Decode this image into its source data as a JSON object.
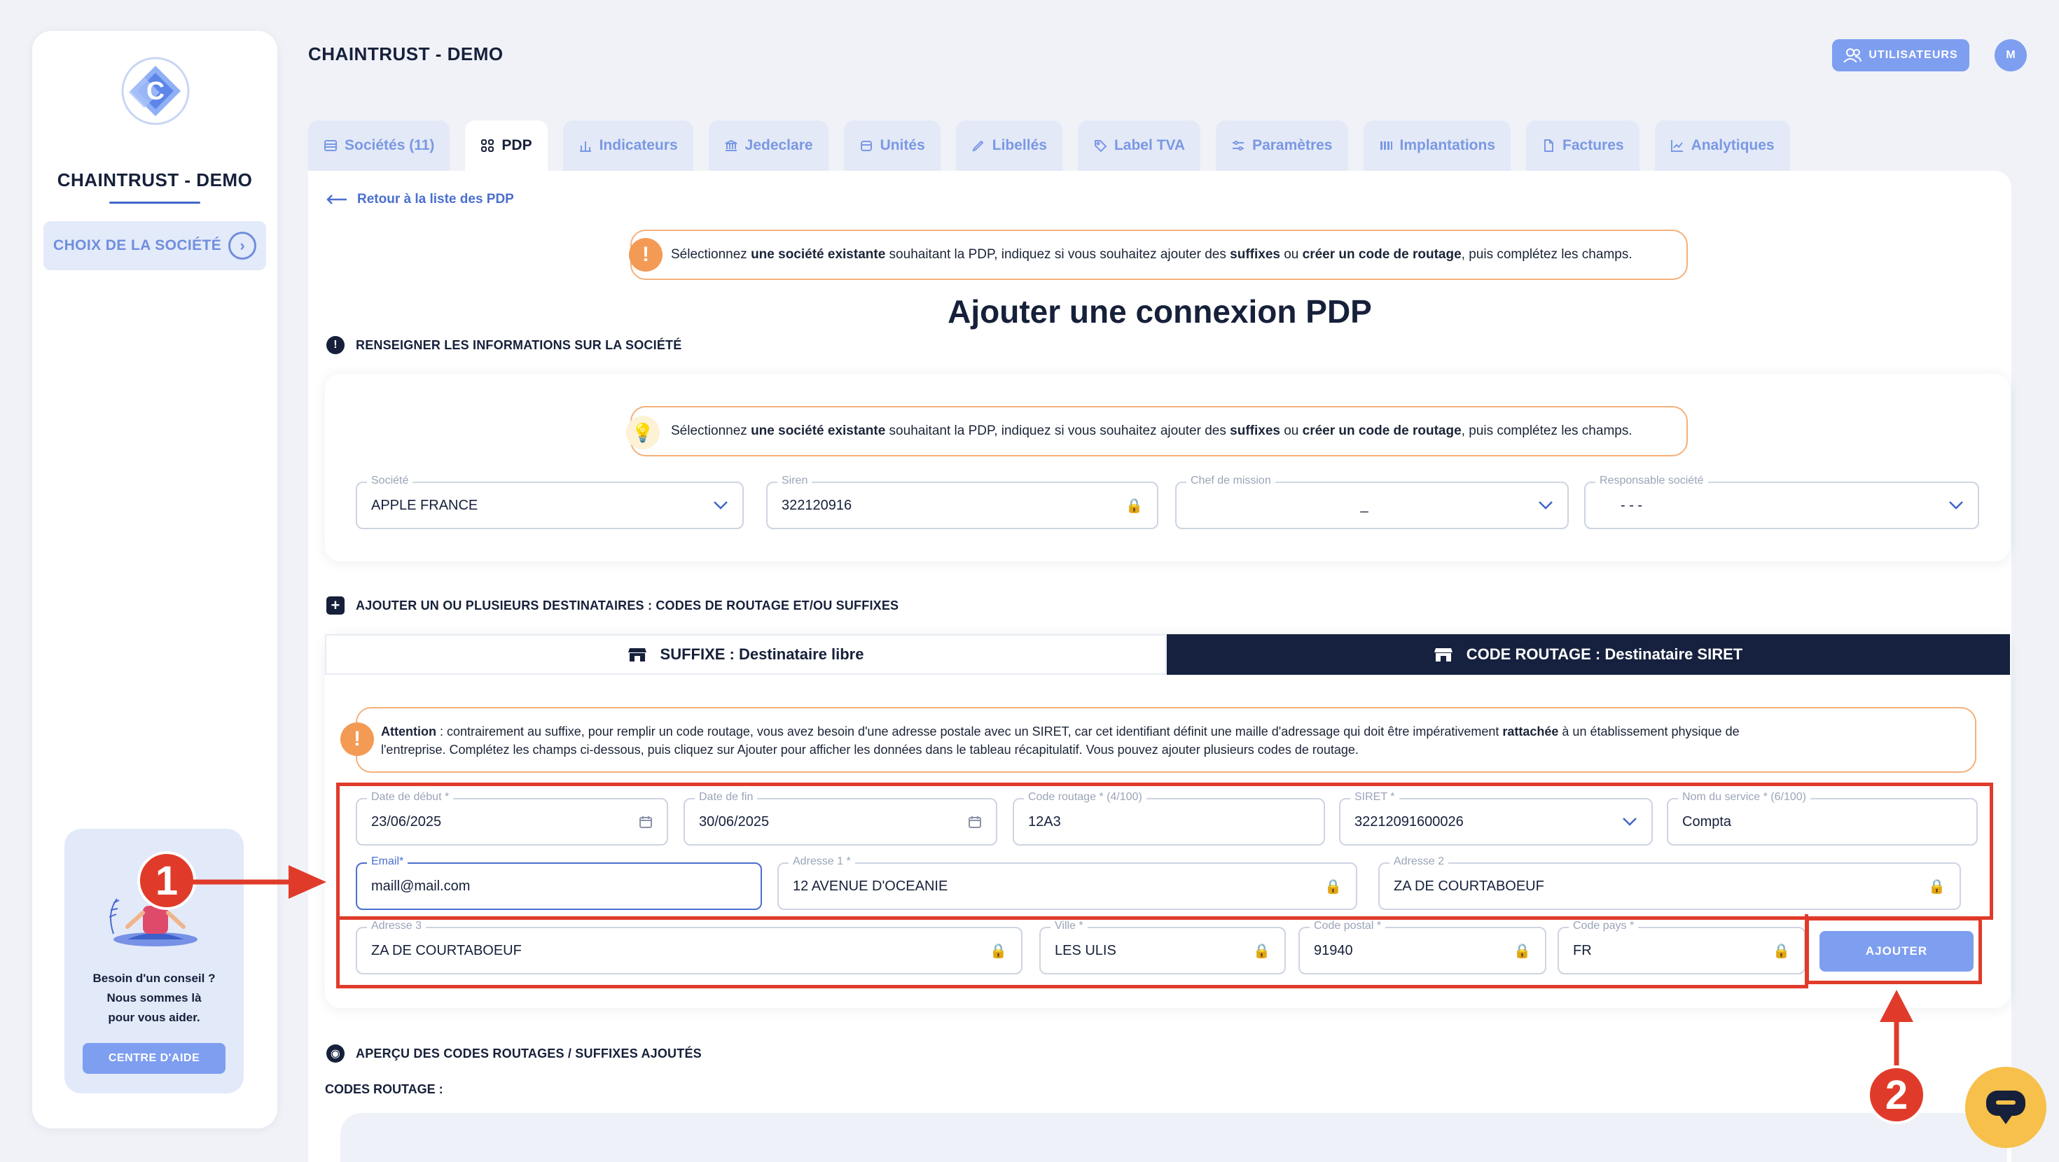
{
  "app": {
    "title": "CHAINTRUST - DEMO",
    "users_label": "UTILISATEURS",
    "avatar_initial": "M"
  },
  "sidebar": {
    "company": "CHAINTRUST - DEMO",
    "choice_label": "CHOIX DE LA SOCIÉTÉ",
    "help_line1": "Besoin d'un conseil ?",
    "help_line2": "Nous sommes là",
    "help_line3": "pour vous aider.",
    "help_button": "CENTRE D'AIDE"
  },
  "tabs": [
    {
      "label": "Sociétés (11)",
      "icon": "table-icon",
      "active": false
    },
    {
      "label": "PDP",
      "icon": "grid-icon",
      "active": true
    },
    {
      "label": "Indicateurs",
      "icon": "bar-chart-icon",
      "active": false
    },
    {
      "label": "Jedeclare",
      "icon": "bank-icon",
      "active": false
    },
    {
      "label": "Unités",
      "icon": "box-icon",
      "active": false
    },
    {
      "label": "Libellés",
      "icon": "pen-icon",
      "active": false
    },
    {
      "label": "Label TVA",
      "icon": "tag-icon",
      "active": false
    },
    {
      "label": "Paramètres",
      "icon": "sliders-icon",
      "active": false
    },
    {
      "label": "Implantations",
      "icon": "columns-icon",
      "active": false
    },
    {
      "label": "Factures",
      "icon": "file-icon",
      "active": false
    },
    {
      "label": "Analytiques",
      "icon": "line-chart-icon",
      "active": false
    }
  ],
  "page": {
    "back_link": "Retour à la liste des PDP",
    "title": "Ajouter une connexion PDP",
    "notice_a": "Sélectionnez ",
    "notice_b": "une société existante",
    "notice_c": " souhaitant la PDP, indiquez si vous souhaitez ajouter des ",
    "notice_d": "suffixes",
    "notice_e": " ou ",
    "notice_f": "créer un code de routage",
    "notice_g": ", puis complétez les champs."
  },
  "company_section": {
    "heading": "RENSEIGNER LES INFORMATIONS SUR LA SOCIÉTÉ",
    "societe_label": "Société",
    "societe_value": "APPLE FRANCE",
    "siren_label": "Siren",
    "siren_value": "322120916",
    "chef_label": "Chef de mission",
    "chef_value": "_",
    "resp_label": "Responsable société",
    "resp_value": "-            - -"
  },
  "recipients_section": {
    "heading": "AJOUTER UN OU PLUSIEURS DESTINATAIRES : CODES DE ROUTAGE ET/OU SUFFIXES",
    "seg_suffix": "SUFFIXE : Destinataire libre",
    "seg_code": "CODE ROUTAGE : Destinataire SIRET",
    "warn_bold1": "Attention",
    "warn_text1": " : contrairement au suffixe, pour remplir un code routage, vous avez besoin d'une adresse postale avec un SIRET, car cet identifiant définit une maille d'adressage qui doit être impérativement ",
    "warn_bold2": "rattachée",
    "warn_text2": " à un établissement physique de",
    "warn_line2": "l'entreprise. Complétez les champs ci-dessous, puis cliquez sur Ajouter pour afficher les données dans le tableau récapitulatif. Vous pouvez ajouter plusieurs codes de routage.",
    "fields": {
      "date_debut_label": "Date de début *",
      "date_debut_value": "23/06/2025",
      "date_fin_label": "Date de fin",
      "date_fin_value": "30/06/2025",
      "code_routage_label": "Code routage * (4/100)",
      "code_routage_value": "12A3",
      "siret_label": "SIRET *",
      "siret_value": "32212091600026",
      "nom_service_label": "Nom du service * (6/100)",
      "nom_service_value": "Compta",
      "email_label": "Email*",
      "email_value": "maill@mail.com",
      "adresse1_label": "Adresse 1 *",
      "adresse1_value": "12 AVENUE D'OCEANIE",
      "adresse2_label": "Adresse 2",
      "adresse2_value": "ZA DE COURTABOEUF",
      "adresse3_label": "Adresse 3",
      "adresse3_value": "ZA DE COURTABOEUF",
      "ville_label": "Ville *",
      "ville_value": "LES ULIS",
      "code_postal_label": "Code postal *",
      "code_postal_value": "91940",
      "code_pays_label": "Code pays *",
      "code_pays_value": "FR"
    },
    "add_button": "AJOUTER"
  },
  "preview_section": {
    "heading": "APERÇU DES CODES ROUTAGES / SUFFIXES AJOUTÉS",
    "sub": "CODES ROUTAGE :"
  },
  "annotations": {
    "badge1": "1",
    "badge2": "2",
    "color": "#e03b2a"
  },
  "colors": {
    "accent": "#7e9ef0",
    "navy": "#16213f",
    "warning": "#f39a55",
    "chat": "#f6c04a"
  }
}
